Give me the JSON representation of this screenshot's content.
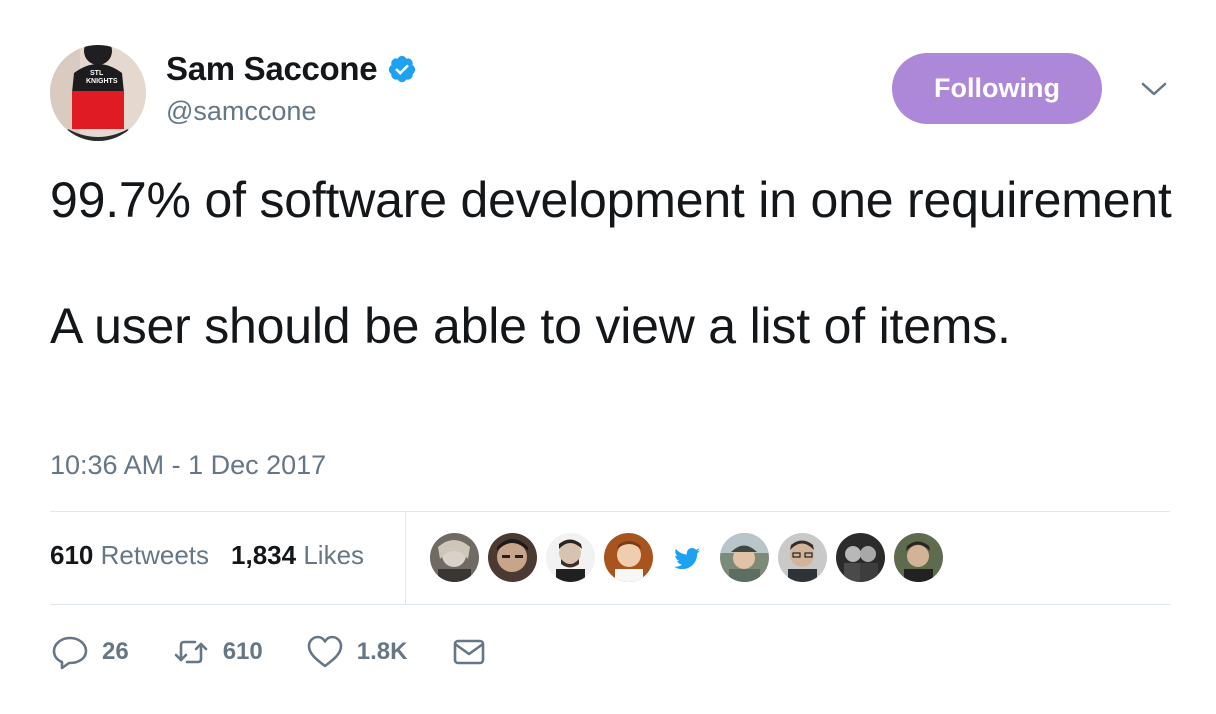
{
  "user": {
    "name": "Sam Saccone",
    "handle": "@samccone",
    "avatar_icon": "avatar-red-beanie",
    "verified": true,
    "hat_text": "STL KNIGHTS"
  },
  "follow_button": {
    "label": "Following",
    "color": "#ad87d8"
  },
  "menu": {
    "icon": "chevron-down-icon"
  },
  "tweet": {
    "text_line1": "99.7% of software development in one requirement",
    "text_line2": "A user should be able to view a list of items.",
    "timestamp": "10:36 AM - 1 Dec 2017"
  },
  "stats": {
    "retweets_count": "610",
    "retweets_label": "Retweets",
    "likes_count": "1,834",
    "likes_label": "Likes"
  },
  "likers": [
    {
      "icon": "avatar"
    },
    {
      "icon": "avatar"
    },
    {
      "icon": "avatar"
    },
    {
      "icon": "avatar"
    },
    {
      "icon": "twitter-bird-icon"
    },
    {
      "icon": "avatar"
    },
    {
      "icon": "avatar"
    },
    {
      "icon": "avatar"
    },
    {
      "icon": "avatar"
    }
  ],
  "actions": {
    "reply": {
      "icon": "reply-icon",
      "count": "26"
    },
    "retweet": {
      "icon": "retweet-icon",
      "count": "610"
    },
    "like": {
      "icon": "heart-icon",
      "count": "1.8K"
    },
    "message": {
      "icon": "envelope-icon"
    }
  },
  "colors": {
    "text": "#14171a",
    "secondary": "#657786",
    "verified": "#1da1f2",
    "divider": "#e1e8ed"
  }
}
